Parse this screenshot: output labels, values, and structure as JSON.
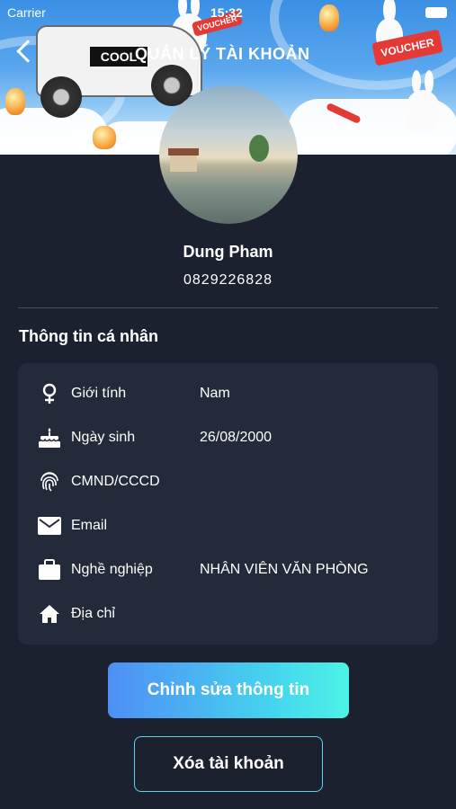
{
  "status_bar": {
    "carrier": "Carrier",
    "time": "15:32"
  },
  "nav": {
    "title": "QUẢN LÝ TÀI KHOẢN",
    "back_icon": "chevron-left-icon"
  },
  "banner": {
    "car_sign": "COOL",
    "voucher_text": "VOUCHER"
  },
  "profile": {
    "name": "Dung Pham",
    "phone": "0829226828"
  },
  "personal_info": {
    "title": "Thông tin cá nhân",
    "rows": [
      {
        "icon": "gender-icon",
        "label": "Giới tính",
        "value": "Nam"
      },
      {
        "icon": "birthday-cake-icon",
        "label": "Ngày sinh",
        "value": "26/08/2000"
      },
      {
        "icon": "fingerprint-icon",
        "label": "CMND/CCCD",
        "value": ""
      },
      {
        "icon": "email-icon",
        "label": "Email",
        "value": ""
      },
      {
        "icon": "briefcase-icon",
        "label": "Nghề nghiệp",
        "value": "NHÂN VIÊN VĂN PHÒNG"
      },
      {
        "icon": "home-icon",
        "label": "Địa chỉ",
        "value": ""
      }
    ]
  },
  "actions": {
    "edit_label": "Chỉnh sửa thông tin",
    "delete_label": "Xóa tài khoản"
  },
  "colors": {
    "background": "#1c2130",
    "card": "#232a3a",
    "accent_start": "#4f8ef5",
    "accent_end": "#4cf3e6"
  }
}
